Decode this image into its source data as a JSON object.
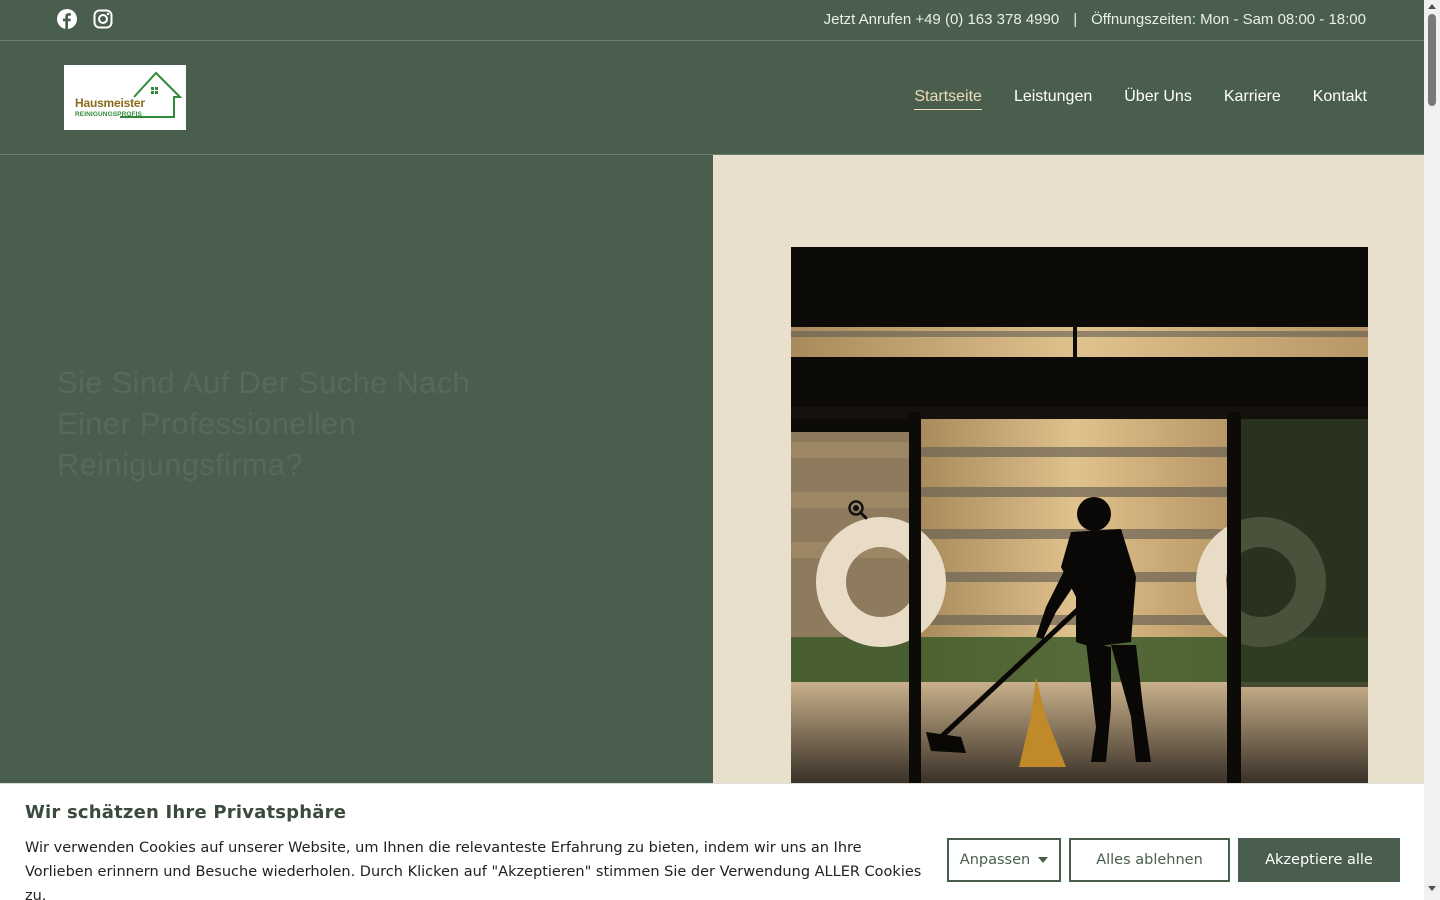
{
  "topbar": {
    "social": [
      "facebook-icon",
      "instagram-icon"
    ],
    "phone_text": "Jetzt Anrufen +49 (0) 163 378 4990",
    "separator": "|",
    "hours_text": "Öffnungszeiten: Mon - Sam 08:00 - 18:00"
  },
  "header": {
    "logo": {
      "line1": "Hausmeister",
      "line2": "REINIGUNGSPROFIS"
    },
    "nav": [
      {
        "label": "Startseite",
        "active": true
      },
      {
        "label": "Leistungen",
        "active": false
      },
      {
        "label": "Über Uns",
        "active": false
      },
      {
        "label": "Karriere",
        "active": false
      },
      {
        "label": "Kontakt",
        "active": false
      }
    ]
  },
  "hero": {
    "title": "Sie Sind Auf Der Suche Nach Einer Professionellen Reinigungsfirma?",
    "image_icon": "zoom-icon"
  },
  "cookie": {
    "title": "Wir schätzen Ihre Privatsphäre",
    "text": "Wir verwenden Cookies auf unserer Website, um Ihnen die relevanteste Erfahrung zu bieten, indem wir uns an Ihre Vorlieben erinnern und Besuche wiederholen. Durch Klicken auf \"Akzeptieren\" stimmen Sie der Verwendung ALLER Cookies zu.",
    "customize_label": "Anpassen",
    "reject_label": "Alles ablehnen",
    "accept_label": "Akzeptiere alle"
  },
  "colors": {
    "primary": "#4a5e4d",
    "beige": "#e8dfcc",
    "nav_active": "#ecdcb8"
  }
}
